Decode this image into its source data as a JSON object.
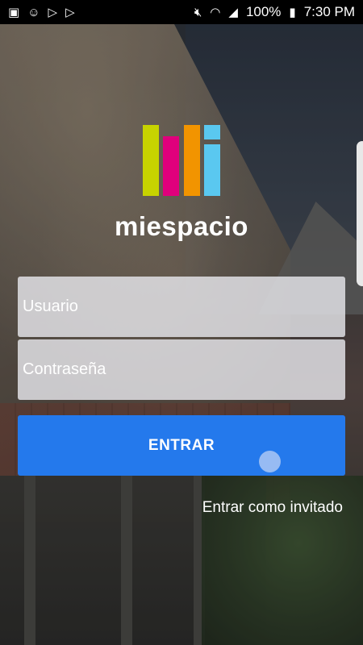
{
  "statusbar": {
    "left_icons": [
      "notification-icon",
      "smiley-icon",
      "play-store-icon",
      "play-store-icon-2"
    ],
    "battery": "100%",
    "time": "7:30 PM"
  },
  "logo": {
    "bar_colors": [
      "#c7d300",
      "#e0007c",
      "#f29400",
      "#5ac8f0"
    ]
  },
  "brand": {
    "name": "miespacio"
  },
  "form": {
    "username_placeholder": "Usuario",
    "password_placeholder": "Contraseña",
    "submit_label": "ENTRAR",
    "guest_link": "Entrar como invitado"
  },
  "colors": {
    "button": "#2479ec",
    "field": "#e6e6eb"
  }
}
